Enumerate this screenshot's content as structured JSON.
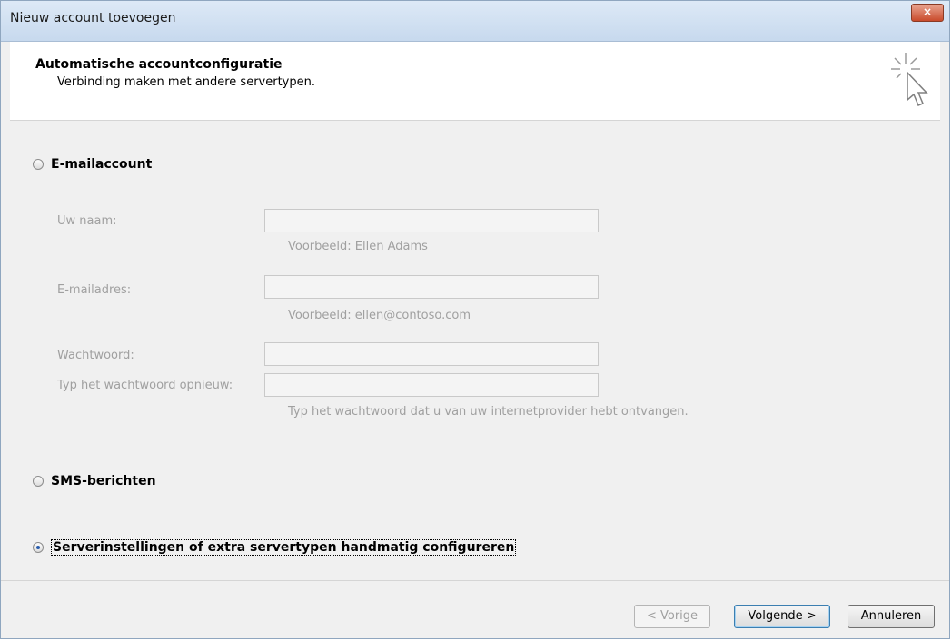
{
  "window": {
    "title": "Nieuw account toevoegen",
    "close_label": "×"
  },
  "header": {
    "title": "Automatische accountconfiguratie",
    "subtitle": "Verbinding maken met andere servertypen."
  },
  "options": {
    "email": {
      "label": "E-mailaccount",
      "checked": false
    },
    "sms": {
      "label": "SMS-berichten",
      "checked": false
    },
    "manual": {
      "label": "Serverinstellingen of extra servertypen handmatig configureren",
      "checked": true
    }
  },
  "form": {
    "name_label": "Uw naam:",
    "name_value": "",
    "name_hint": "Voorbeeld: Ellen Adams",
    "email_label": "E-mailadres:",
    "email_value": "",
    "email_hint": "Voorbeeld: ellen@contoso.com",
    "password_label": "Wachtwoord:",
    "password_value": "",
    "password_repeat_label": "Typ het wachtwoord opnieuw:",
    "password_repeat_value": "",
    "password_hint": "Typ het wachtwoord dat u van uw internetprovider hebt ontvangen."
  },
  "buttons": {
    "back": "< Vorige",
    "next": "Volgende >",
    "cancel": "Annuleren"
  },
  "colors": {
    "title_bar": "#c7d9ee",
    "close_button": "#c94b2b",
    "radio_selected": "#2a5dad"
  }
}
